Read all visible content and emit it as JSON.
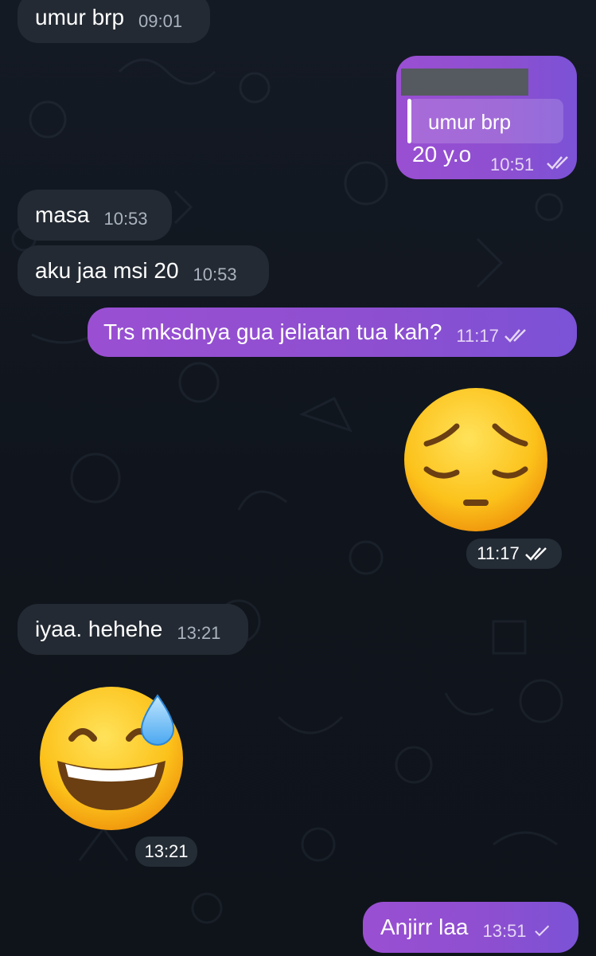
{
  "messages": [
    {
      "text": "umur brp",
      "time": "09:01"
    },
    {
      "reply_quote": "umur brp",
      "text": "20 y.o",
      "time": "10:51"
    },
    {
      "text": "masa",
      "time": "10:53"
    },
    {
      "text": "aku jaa msi 20",
      "time": "10:53"
    },
    {
      "text": "Trs mksdnya gua jeliatan tua kah?",
      "time": "11:17"
    },
    {
      "emoji": "pensive-face",
      "time": "11:17"
    },
    {
      "text": "iyaa. hehehe",
      "time": "13:21"
    },
    {
      "emoji": "grinning-face-with-sweat",
      "time": "13:21"
    },
    {
      "text": "Anjirr laa",
      "time": "13:51"
    }
  ],
  "colors": {
    "background": "#141a24",
    "incoming_bubble": "#232a33",
    "outgoing_bubble": "#8d4fd0"
  }
}
